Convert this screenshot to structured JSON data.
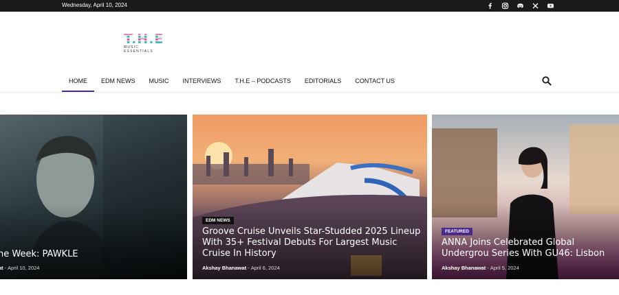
{
  "topbar": {
    "date": "Wednesday, April 10, 2024",
    "social": [
      "facebook-icon",
      "instagram-icon",
      "discord-icon",
      "x-icon",
      "youtube-icon"
    ]
  },
  "logo": {
    "main": "T.H.E",
    "line1": "MUSIC",
    "line2": "ESSENTIALS"
  },
  "nav": {
    "items": [
      {
        "label": "HOME",
        "active": true
      },
      {
        "label": "EDM NEWS"
      },
      {
        "label": "MUSIC"
      },
      {
        "label": "INTERVIEWS"
      },
      {
        "label": "T.H.E – PODCASTS"
      },
      {
        "label": "EDITORIALS"
      },
      {
        "label": "CONTACT US"
      }
    ],
    "search_icon": "search-icon"
  },
  "cards": [
    {
      "title": "he Week: PAWKLE",
      "author": "at",
      "date": "April 10, 2024"
    },
    {
      "category": "EDM NEWS",
      "title": "Groove Cruise Unveils Star-Studded 2025 Lineup With 35+ Festival Debuts For Largest Music Cruise In History",
      "author": "Akshay Bhanawat",
      "date": "April 6, 2024"
    },
    {
      "category": "FEATURED",
      "title": "ANNA Joins Celebrated Global Undergrou Series With GU46: Lisbon",
      "author": "Akshay Bhanawat",
      "date": "April 5, 2024"
    }
  ],
  "colors": {
    "accent": "#4a2b8c",
    "topbar": "#1a1a1a"
  }
}
